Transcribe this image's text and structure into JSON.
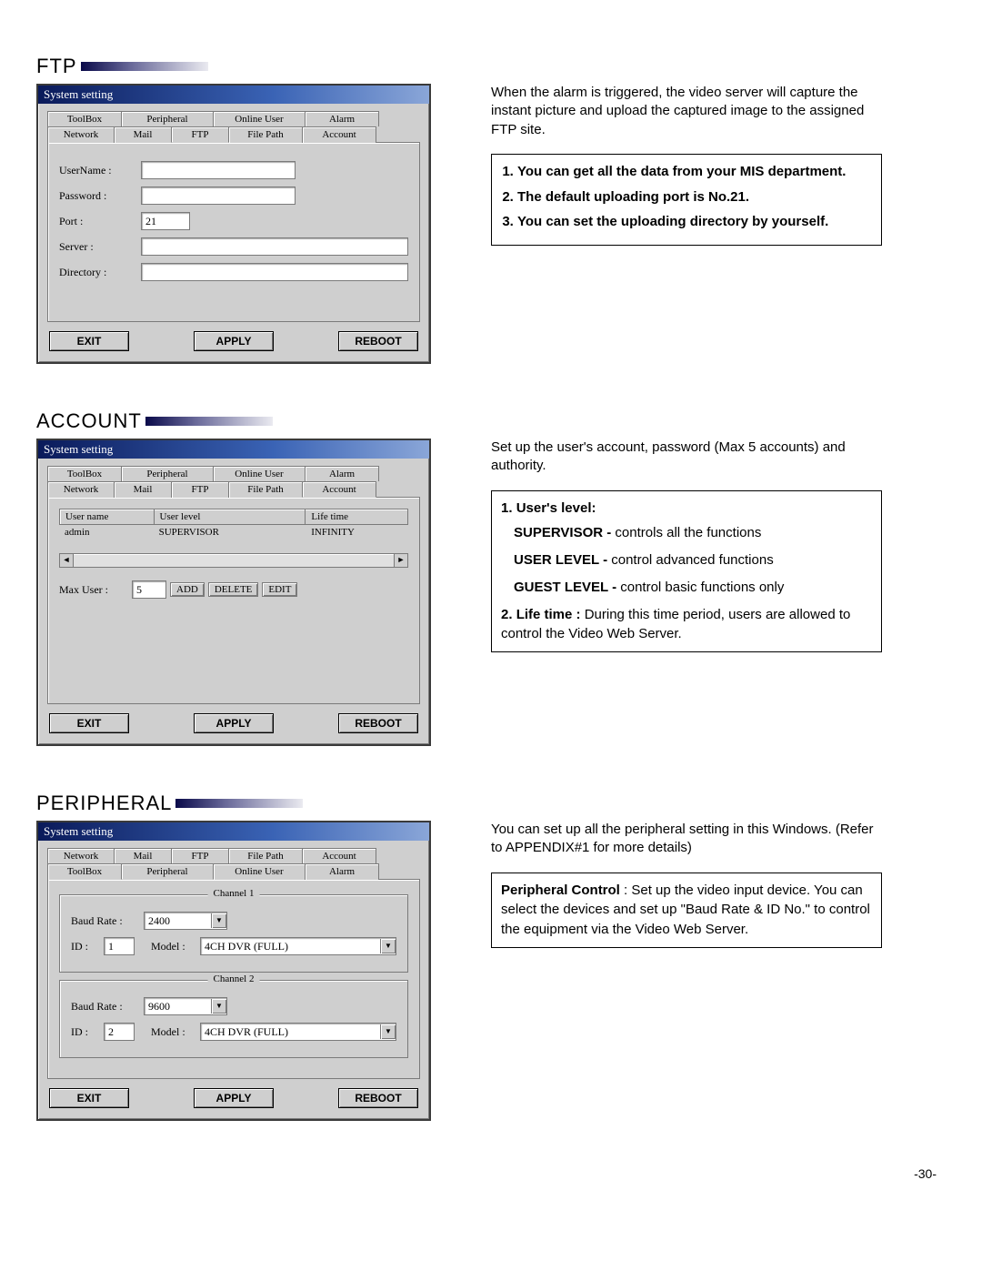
{
  "page_number": "-30-",
  "ftp": {
    "heading": "FTP",
    "window_title": "System setting",
    "tabs_top": [
      "ToolBox",
      "Peripheral",
      "Online User",
      "Alarm"
    ],
    "tabs_bot": [
      "Network",
      "Mail",
      "FTP",
      "File Path",
      "Account"
    ],
    "active_tab": "FTP",
    "labels": {
      "username": "UserName :",
      "password": "Password :",
      "port": "Port :",
      "server": "Server :",
      "directory": "Directory :"
    },
    "values": {
      "username": "",
      "password": "",
      "port": "21",
      "server": "",
      "directory": ""
    },
    "buttons": {
      "exit": "EXIT",
      "apply": "APPLY",
      "reboot": "REBOOT"
    },
    "desc": "When the alarm is triggered, the video server will capture the instant picture and upload the captured image to the assigned FTP site.",
    "notes": [
      "You can get all the data from your MIS department.",
      "The default uploading port is No.21.",
      "You can set the uploading directory by yourself."
    ]
  },
  "account": {
    "heading": "ACCOUNT",
    "window_title": "System setting",
    "tabs_top": [
      "ToolBox",
      "Peripheral",
      "Online User",
      "Alarm"
    ],
    "tabs_bot": [
      "Network",
      "Mail",
      "FTP",
      "File Path",
      "Account"
    ],
    "active_tab": "Account",
    "columns": [
      "User name",
      "User level",
      "Life time"
    ],
    "row": {
      "user": "admin",
      "level": "SUPERVISOR",
      "life": "INFINITY"
    },
    "maxuser_label": "Max User :",
    "maxuser_value": "5",
    "btn_add": "ADD",
    "btn_delete": "DELETE",
    "btn_edit": "EDIT",
    "buttons": {
      "exit": "EXIT",
      "apply": "APPLY",
      "reboot": "REBOOT"
    },
    "desc": "Set up the user's account, password (Max 5 accounts) and authority.",
    "note_intro": "User's level:",
    "levels": [
      {
        "name": "SUPERVISOR -",
        "text": " controls all the functions"
      },
      {
        "name": "USER LEVEL -",
        "text": " control advanced functions"
      },
      {
        "name": "GUEST LEVEL -",
        "text": " control basic functions only"
      }
    ],
    "lifetime_label": "Life time :",
    "lifetime_text": " During this time period, users are allowed to control the Video Web Server."
  },
  "peripheral": {
    "heading": "PERIPHERAL",
    "window_title": "System setting",
    "tabs_top": [
      "Network",
      "Mail",
      "FTP",
      "File Path",
      "Account"
    ],
    "tabs_bot": [
      "ToolBox",
      "Peripheral",
      "Online User",
      "Alarm"
    ],
    "active_tab": "Peripheral",
    "ch1": {
      "legend": "Channel 1",
      "baud_label": "Baud Rate :",
      "baud": "2400",
      "id_label": "ID :",
      "id": "1",
      "model_label": "Model :",
      "model": "4CH DVR (FULL)"
    },
    "ch2": {
      "legend": "Channel 2",
      "baud_label": "Baud Rate :",
      "baud": "9600",
      "id_label": "ID :",
      "id": "2",
      "model_label": "Model :",
      "model": "4CH DVR (FULL)"
    },
    "buttons": {
      "exit": "EXIT",
      "apply": "APPLY",
      "reboot": "REBOOT"
    },
    "desc": "You can set up all the peripheral setting in this Windows. (Refer to APPENDIX#1 for more details)",
    "note_label": "Peripheral Control",
    "note_text": " : Set up the video input device. You can select the devices and set up \"Baud Rate & ID No.\" to control the equipment via the Video Web Server."
  }
}
